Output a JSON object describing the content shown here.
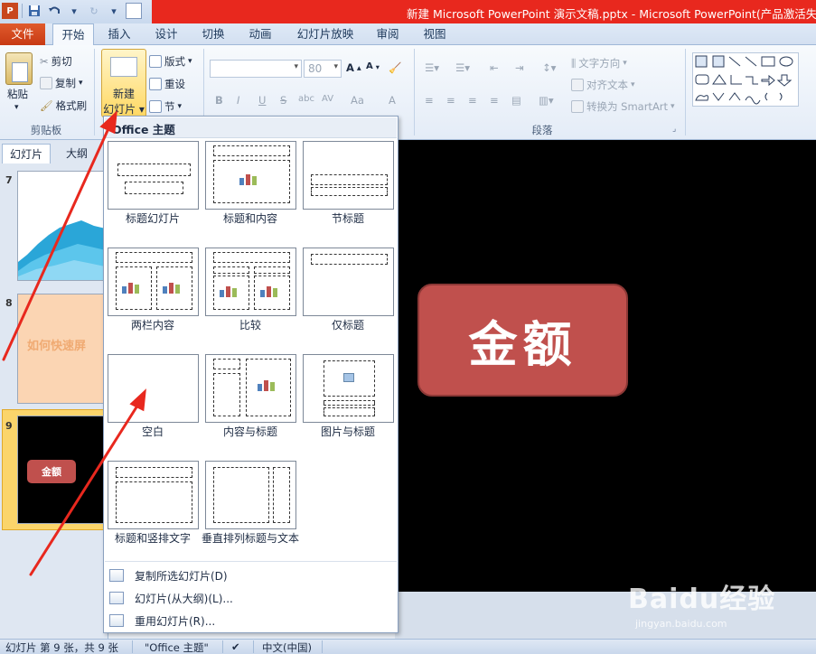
{
  "window": {
    "title": "新建 Microsoft PowerPoint 演示文稿.pptx - Microsoft PowerPoint(产品激活失败)"
  },
  "tabs": {
    "file": "文件",
    "home": "开始",
    "insert": "插入",
    "design": "设计",
    "transitions": "切换",
    "animations": "动画",
    "slideshow": "幻灯片放映",
    "review": "审阅",
    "view": "视图"
  },
  "ribbon": {
    "clipboard": {
      "paste": "粘贴",
      "cut": "剪切",
      "copy": "复制",
      "format_painter": "格式刷",
      "group_label": "剪贴板"
    },
    "slides": {
      "new_slide_line1": "新建",
      "new_slide_line2": "幻灯片",
      "layout": "版式",
      "reset": "重设",
      "section": "节"
    },
    "font": {
      "font_name": "",
      "font_size": "80",
      "bold": "B",
      "italic": "I",
      "underline": "U",
      "strike": "S",
      "shadow": "abc",
      "spacing": "AV",
      "case": "Aa",
      "color": "A"
    },
    "paragraph": {
      "text_direction": "文字方向",
      "align_text": "对齐文本",
      "convert_smartart": "转换为 SmartArt",
      "group_label": "段落"
    }
  },
  "left_panel": {
    "tab_slides": "幻灯片",
    "tab_outline": "大纲",
    "slides": [
      {
        "number": "7"
      },
      {
        "number": "8",
        "text": "如何快速屏"
      },
      {
        "number": "9",
        "text": "金额"
      }
    ]
  },
  "slide": {
    "text": "金额"
  },
  "layout_gallery": {
    "header": "Office 主题",
    "layouts": [
      {
        "label": "标题幻灯片"
      },
      {
        "label": "标题和内容"
      },
      {
        "label": "节标题"
      },
      {
        "label": "两栏内容"
      },
      {
        "label": "比较"
      },
      {
        "label": "仅标题"
      },
      {
        "label": "空白"
      },
      {
        "label": "内容与标题"
      },
      {
        "label": "图片与标题"
      },
      {
        "label": "标题和竖排文字"
      },
      {
        "label": "垂直排列标题与文本"
      }
    ],
    "commands": [
      {
        "label": "复制所选幻灯片(D)"
      },
      {
        "label": "幻灯片(从大纲)(L)..."
      },
      {
        "label": "重用幻灯片(R)..."
      }
    ]
  },
  "status_bar": {
    "slide_info": "幻灯片 第 9 张，共 9 张",
    "theme": "\"Office 主题\"",
    "language": "中文(中国)"
  },
  "watermark": {
    "brand": "Baidu经验",
    "url": "jingyan.baidu.com"
  },
  "colors": {
    "file_tab": "#d24726",
    "title_bar_red": "#e8281e",
    "kingaku_box": "#c0504d",
    "selected_slide": "#fbd56b",
    "annotation_arrow": "#e8281e"
  }
}
